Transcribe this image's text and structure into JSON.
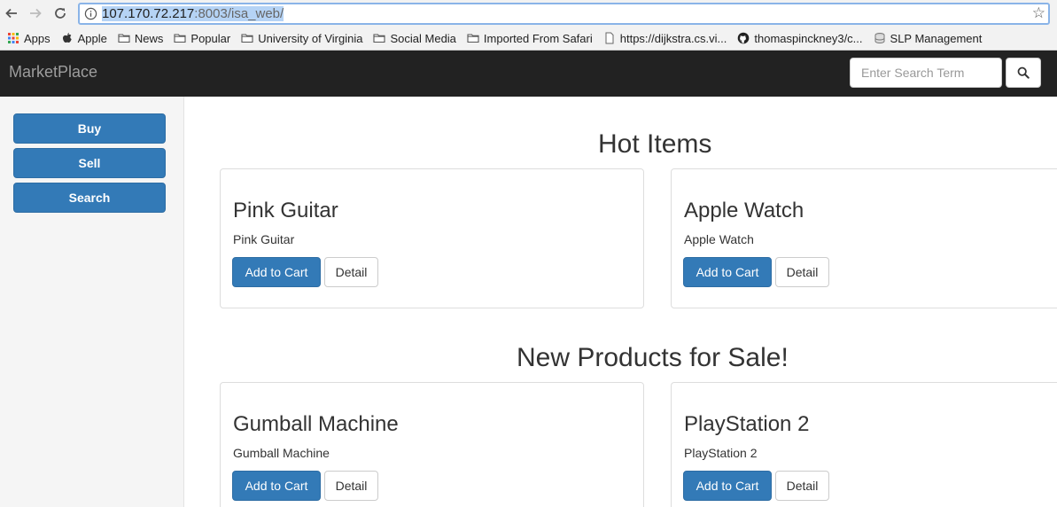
{
  "browser": {
    "url_host": "107.170.72.217",
    "url_path": ":8003/isa_web/",
    "bookmarks": [
      {
        "label": "Apps",
        "icon": "apps-grid-icon"
      },
      {
        "label": "Apple",
        "icon": "apple-logo-icon"
      },
      {
        "label": "News",
        "icon": "folder-icon"
      },
      {
        "label": "Popular",
        "icon": "folder-icon"
      },
      {
        "label": "University of Virginia",
        "icon": "folder-icon"
      },
      {
        "label": "Social Media",
        "icon": "folder-icon"
      },
      {
        "label": "Imported From Safari",
        "icon": "folder-icon"
      },
      {
        "label": "https://dijkstra.cs.vi...",
        "icon": "page-icon"
      },
      {
        "label": "thomaspinckney3/c...",
        "icon": "github-icon"
      },
      {
        "label": "SLP Management",
        "icon": "database-icon"
      }
    ]
  },
  "navbar": {
    "brand": "MarketPlace",
    "search_placeholder": "Enter Search Term"
  },
  "sidebar": {
    "buttons": [
      {
        "label": "Buy"
      },
      {
        "label": "Sell"
      },
      {
        "label": "Search"
      }
    ]
  },
  "sections": [
    {
      "title": "Hot Items",
      "items": [
        {
          "name": "Pink Guitar",
          "description": "Pink Guitar",
          "cart_label": "Add to Cart",
          "detail_label": "Detail"
        },
        {
          "name": "Apple Watch",
          "description": "Apple Watch",
          "cart_label": "Add to Cart",
          "detail_label": "Detail"
        }
      ]
    },
    {
      "title": "New Products for Sale!",
      "items": [
        {
          "name": "Gumball Machine",
          "description": "Gumball Machine",
          "cart_label": "Add to Cart",
          "detail_label": "Detail"
        },
        {
          "name": "PlayStation 2",
          "description": "PlayStation 2",
          "cart_label": "Add to Cart",
          "detail_label": "Detail"
        }
      ]
    }
  ],
  "colors": {
    "primary": "#337ab7",
    "navbar_bg": "#222222",
    "sidebar_bg": "#f5f5f5"
  }
}
